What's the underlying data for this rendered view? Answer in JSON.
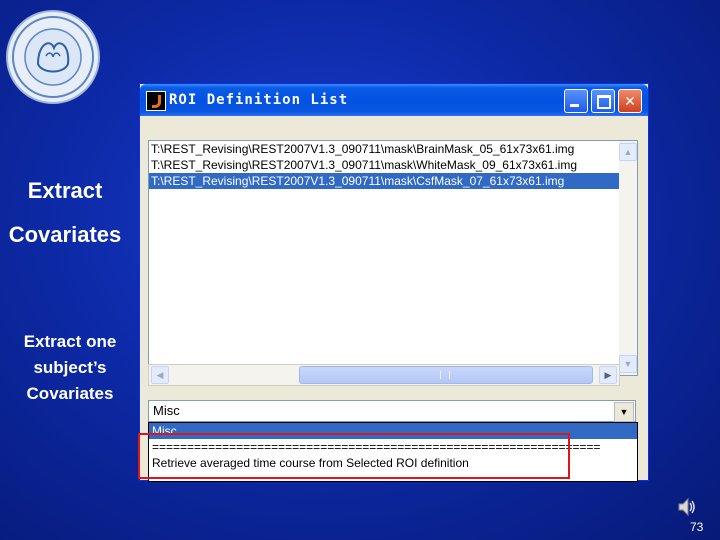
{
  "slide": {
    "heading_line1": "Extract",
    "heading_line2": "Covariates",
    "subtitle": "Extract one subject’s Covariates",
    "page_number": "73"
  },
  "window": {
    "title": "ROI Definition List",
    "minimize_label": "",
    "maximize_label": "",
    "close_label": "✕"
  },
  "roi_list": {
    "items": [
      {
        "text": "T:\\REST_Revising\\REST2007V1.3_090711\\mask\\BrainMask_05_61x73x61.img",
        "selected": false
      },
      {
        "text": "T:\\REST_Revising\\REST2007V1.3_090711\\mask\\WhiteMask_09_61x73x61.img",
        "selected": false
      },
      {
        "text": "T:\\REST_Revising\\REST2007V1.3_090711\\mask\\CsfMask_07_61x73x61.img",
        "selected": true
      }
    ]
  },
  "dropdown": {
    "selected_value": "Misc",
    "options": [
      "Misc",
      "================================================================",
      "Retrieve averaged time course from Selected ROI definition"
    ]
  },
  "colors": {
    "accent": "#316ac5",
    "highlight_border": "#e0151b",
    "background": "#0d2aa8"
  }
}
